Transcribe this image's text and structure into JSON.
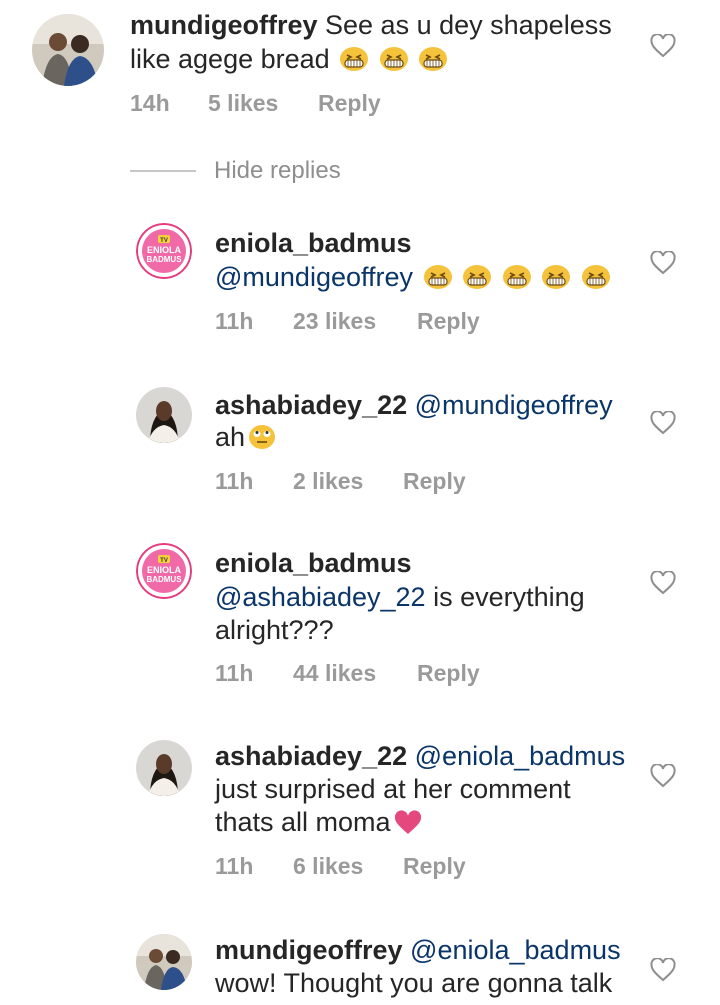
{
  "comments": [
    {
      "user": "mundigeoffrey",
      "mention": "",
      "line1": " See as u dey shapeless",
      "line2": "like agege bread",
      "emoji_count": 3,
      "time": "14h",
      "likes": "5 likes",
      "reply": "Reply"
    },
    {
      "user": "eniola_badmus",
      "mention": "@mundigeoffrey",
      "line1": "",
      "line2": "",
      "emoji_count": 5,
      "time": "11h",
      "likes": "23 likes",
      "reply": "Reply"
    },
    {
      "user": "ashabiadey_22",
      "mention": "@mundigeoffrey",
      "line1": "ah",
      "line2": "",
      "emoji_count": 0,
      "time": "11h",
      "likes": "2 likes",
      "reply": "Reply"
    },
    {
      "user": "eniola_badmus",
      "mention": "@ashabiadey_22",
      "line1": " is everything",
      "line2": "alright???",
      "emoji_count": 0,
      "time": "11h",
      "likes": "44 likes",
      "reply": "Reply"
    },
    {
      "user": "ashabiadey_22",
      "mention": "@eniola_badmus",
      "line1": "just surprised at her comment",
      "line2": "thats all moma",
      "emoji_count": 0,
      "time": "11h",
      "likes": "6 likes",
      "reply": "Reply"
    },
    {
      "user": "mundigeoffrey",
      "mention": "@eniola_badmus",
      "line1": "wow! Thought you are gonna talk",
      "line2": "",
      "emoji_count": 0,
      "time": "",
      "likes": "",
      "reply": ""
    }
  ],
  "replies_toggle": "Hide replies",
  "avatar_text": {
    "tv": "TV",
    "brand_top": "ENIOLA",
    "brand_bottom": "BADMUS"
  },
  "colors": {
    "mention": "#0a3569",
    "meta": "#9a9a9a",
    "text": "#262626",
    "avatar_ring": "#e63a7d"
  },
  "icons": {
    "like": "heart-outline-icon",
    "laugh": "grinning-squinting-face-icon",
    "eyeroll": "face-with-rolling-eyes-icon",
    "love": "pink-heart-icon"
  }
}
